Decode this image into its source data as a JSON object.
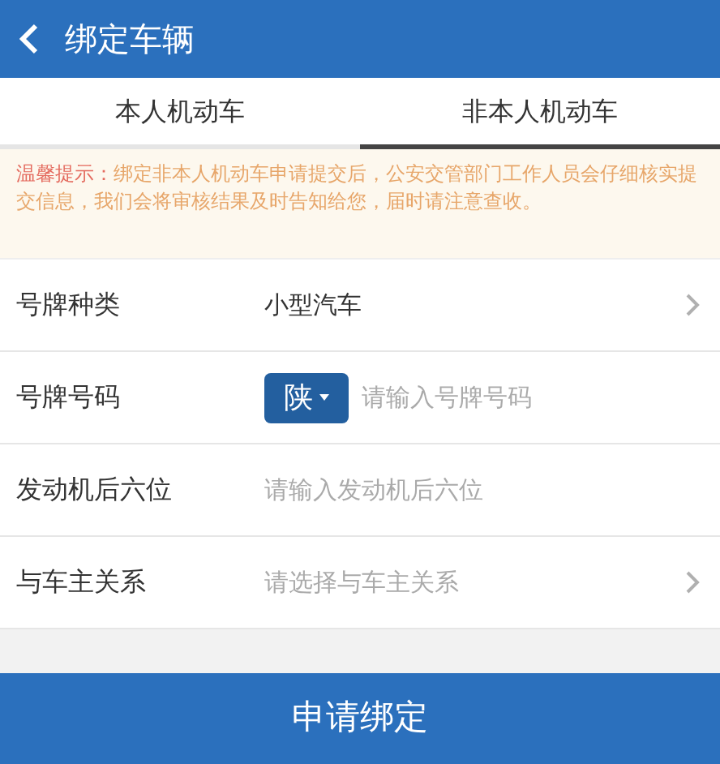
{
  "header": {
    "title": "绑定车辆"
  },
  "tabs": [
    {
      "label": "本人机动车",
      "selected": false
    },
    {
      "label": "非本人机动车",
      "selected": true
    }
  ],
  "notice": {
    "label": "温馨提示：",
    "text": "绑定非本人机动车申请提交后，公安交管部门工作人员会仔细核实提交信息，我们会将审核结果及时告知给您，届时请注意查收。"
  },
  "form": [
    {
      "kind": "select",
      "label": "号牌种类",
      "value": "小型汽车"
    },
    {
      "kind": "plate",
      "label": "号牌号码",
      "prefix": "陕",
      "placeholder": "请输入号牌号码"
    },
    {
      "kind": "input",
      "label": "发动机后六位",
      "placeholder": "请输入发动机后六位"
    },
    {
      "kind": "select",
      "label": "与车主关系",
      "placeholder": "请选择与车主关系"
    }
  ],
  "submit": {
    "label": "申请绑定"
  }
}
